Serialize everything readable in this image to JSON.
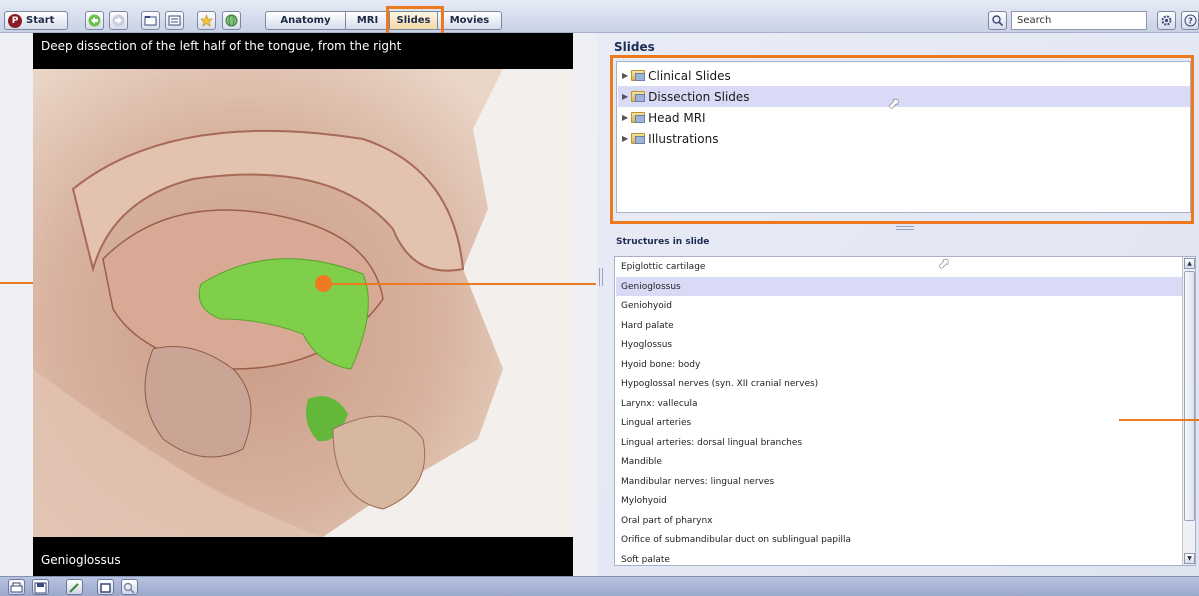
{
  "toolbar": {
    "start_label": "Start",
    "start_logo": "P",
    "tabs": [
      {
        "label": "Anatomy",
        "active": false
      },
      {
        "label": "MRI",
        "active": false
      },
      {
        "label": "Slides",
        "active": true
      },
      {
        "label": "Movies",
        "active": false
      }
    ],
    "search_placeholder": "Search",
    "icons": [
      "back-arrow-icon",
      "forward-arrow-icon",
      "folder-icon",
      "list-icon",
      "star-icon",
      "globe-icon",
      "search-icon",
      "settings-icon",
      "help-icon"
    ]
  },
  "image_panel": {
    "caption_top": "Deep dissection of the left half of the tongue, from the right",
    "caption_bottom": "Genioglossus",
    "highlight_color": "#7fcf4a"
  },
  "slides": {
    "title": "Slides",
    "items": [
      {
        "label": "Clinical Slides",
        "selected": false
      },
      {
        "label": "Dissection Slides",
        "selected": true
      },
      {
        "label": "Head MRI",
        "selected": false
      },
      {
        "label": "Illustrations",
        "selected": false
      }
    ]
  },
  "structures": {
    "title": "Structures in slide",
    "items": [
      {
        "label": "Epiglottic cartilage",
        "selected": false
      },
      {
        "label": "Genioglossus",
        "selected": true
      },
      {
        "label": "Geniohyoid",
        "selected": false
      },
      {
        "label": "Hard palate",
        "selected": false
      },
      {
        "label": "Hyoglossus",
        "selected": false
      },
      {
        "label": "Hyoid bone: body",
        "selected": false
      },
      {
        "label": "Hypoglossal nerves (syn. XII cranial nerves)",
        "selected": false
      },
      {
        "label": "Larynx: vallecula",
        "selected": false
      },
      {
        "label": "Lingual arteries",
        "selected": false
      },
      {
        "label": "Lingual arteries: dorsal lingual branches",
        "selected": false
      },
      {
        "label": "Mandible",
        "selected": false
      },
      {
        "label": "Mandibular nerves: lingual nerves",
        "selected": false
      },
      {
        "label": "Mylohyoid",
        "selected": false
      },
      {
        "label": "Oral part of pharynx",
        "selected": false
      },
      {
        "label": "Orifice of submandibular duct on sublingual papilla",
        "selected": false
      },
      {
        "label": "Soft palate",
        "selected": false
      }
    ]
  },
  "bottom_bar": {
    "icons": [
      "print-icon",
      "save-icon",
      "pen-icon",
      "frame-icon",
      "zoom-icon"
    ]
  },
  "colors": {
    "annotation": "#ee7a1f",
    "selection": "#d8daf6",
    "heading": "#1e2d52"
  }
}
